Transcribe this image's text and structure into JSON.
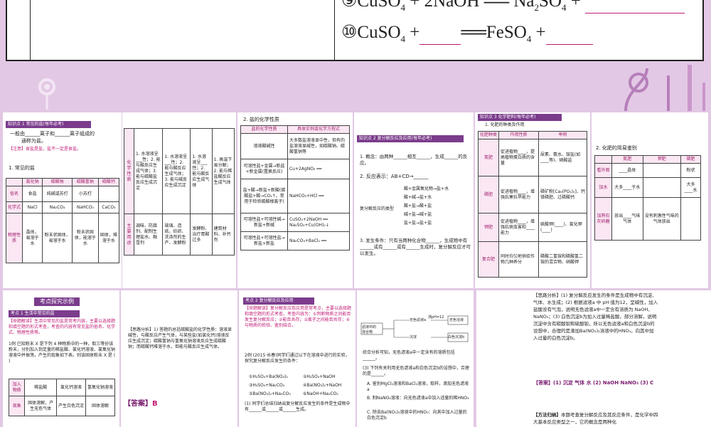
{
  "top": {
    "eq9_prefix": "⑨CuSO",
    "eq9_mid": "+2NaOH",
    "eq9_product": "Na",
    "eq9_product2": "SO",
    "eq9_plus": "+",
    "eq10_prefix": "⑩CuSO",
    "eq10_plus1": "+",
    "eq10_arrow": "══FeSO",
    "eq10_plus2": "+",
    "sub4": "4",
    "sub2": "2"
  },
  "panel1": {
    "section_title": "知识点 1 常见的盐(每年必考)",
    "line1": "一般由______离子和______离子组成的",
    "line2": "通称为盐。",
    "note": "【注意】食盐是盐，盐不一定是食盐。",
    "table_title": "1. 常见的盐",
    "headers": [
      "",
      "氯化钠",
      "碳酸钠",
      "碳酸氢钠",
      "碳酸钙"
    ],
    "row_name": [
      "俗名",
      "食盐",
      "纯碱或苏打",
      "小苏打",
      ""
    ],
    "row_formula": [
      "化学式",
      "NaCl",
      "Na₂CO₃",
      "NaHCO₃",
      "CaCO₃"
    ],
    "row_phys": [
      "物理性质",
      "晶体，易溶于水",
      "粉末状固体，易溶于水",
      "粉末状固体，能溶于水",
      "固体，难溶于水"
    ]
  },
  "panel2": {
    "col1": [
      "化学性质",
      "主要用途"
    ],
    "col2": [
      "1. 水溶液呈___性；2. 能与酸反应生成气体；3. 能与碳酸盐反应生成沉淀",
      "调味、防腐剂、配制生理盐水、融雪剂"
    ],
    "col3": [
      "1. 水溶液呈___性；2. 能与酸反应生成气体；3. 能与碱反应生成沉淀",
      "玻璃、造纸、纺织、洗涤剂的生产、发酵粉"
    ],
    "col4": [
      "1. 水溶液呈___性；2. 能与酸反应生成气体",
      "发酵粉、治疗胃酸过多"
    ],
    "col5": [
      "1. 高温下易分解；2. 能与稀盐酸反应生成气体",
      "建筑材料、补钙剂"
    ]
  },
  "panel3": {
    "title": "2. 盐的化学性质",
    "headers": [
      "盐的化学性质",
      "具体实例或化学方程式"
    ],
    "rows": [
      [
        "溶液酸碱性",
        "大多数盐溶液显中性，但有的盐溶液显碱性，如碳酸钠、碳酸氢钠等"
      ],
      [
        "可溶性盐+金属→新盐+新金属(置换反应)",
        "Cu+2AgNO₃ ══"
      ],
      [
        "盐+酸→新盐+新酸(碳酸盐+酸→CO₂↑，常用于检验碳酸根离子)",
        "NaHCO₃+HCl ══"
      ],
      [
        "可溶性盐+可溶性碱→新盐+新碱",
        "CuSO₄+2NaOH ══ Na₂SO₄+Cu(OH)₂↓"
      ],
      [
        "可溶性盐+可溶性盐→新盐+新盐",
        "Na₂CO₃+BaCl₂ ══"
      ]
    ]
  },
  "panel4": {
    "section_title": "知识点 2 复分解反应及应用(每年必考)",
    "def": "1. 概念：由两种______相互______，生成______的反应。",
    "expr": "2. 反应表示：AB+CD→______",
    "types_label": "复分解反应的类型",
    "types": [
      "酸+金属氧化物→盐+水",
      "酸+碱→盐+水",
      "酸+盐→酸+盐",
      "碱+盐→碱+盐",
      "盐+盐→盐+盐"
    ],
    "cond": "3. 发生条件：只有当两种化合物______，生成物中有______或有______或有______生成时，复分解反应才可以发生。"
  },
  "panel5": {
    "section_title": "知识点 3 化学肥料(每年必考)",
    "subtitle": "1. 化肥的种类及作用",
    "headers": [
      "化肥种类",
      "作用性质",
      "举例"
    ],
    "rows": [
      [
        "氮肥",
        "促进植物____，提高植物蛋白质的含量",
        "尿素、氨水、铵盐(如____等)、硝酸盐"
      ],
      [
        "磷肥",
        "促进植物____，增强抗寒抗旱能力",
        "磷矿粉[Ca₃(PO₄)₂]、钙镁磷肥、过磷酸钙"
      ],
      [
        "钾肥",
        "促进植物____，增强抗病虫害和____能力",
        "硫酸钾(____)、氯化钾(____)"
      ],
      [
        "复合肥",
        "同时均匀地供给作物几种养分",
        "磷酸二氢铵和磷酸氢二铵的混合物、硝酸钾"
      ]
    ]
  },
  "panel6": {
    "title": "2. 化肥的简易鉴别",
    "headers": [
      "",
      "氮肥",
      "钾肥",
      "磷肥"
    ],
    "row1": [
      "看外观",
      "____晶体",
      "",
      "粉状"
    ],
    "row2": [
      "加水",
      "大多____于水",
      "",
      "大多____水"
    ],
    "row3": [
      "加熟石灰研磨",
      "放出____气味气体",
      "没有刺激性气味的气体放出",
      ""
    ]
  },
  "panel7": {
    "banner": "考点探究示例",
    "kp_title": "考点 1 生活中常见的盐",
    "hint": "【命题解读】生活中常见的盐是常考内容，主要以选择题和填空题的形式考查，考查的内容有常见盐的俗名、化学式、物理性质等。",
    "ex": "1例 已知粉末 X 是下列 4 种物质中的一种，取三等份该粉末，分别加入到足量的稀盐酸、氯化钙溶液、氯氧化钠溶液中并振荡，产生的现象如下表。则该固体粉末 X 是 (    )",
    "t_headers": [
      "加入物质",
      "稀盐酸",
      "氯化钙溶液",
      "氢氧化钠溶液"
    ],
    "t_row": [
      "现象",
      "固体溶解，产生无色气体",
      "产生白色沉淀",
      "固体溶解"
    ]
  },
  "panel8": {
    "analysis": "【思路分析】1) 答题的总括碳酸盐的化学性质：溶液显碱性，与酸反应产生气体，与某些盐(如氯化钙)溶液反应生成沉淀；碳酸氢钠与氢氧化钠溶液反应生成碳酸钠；而碳酸钙难溶于水，但能与酸反应生成气体。",
    "answer_label": "【答案】",
    "answer": "B"
  },
  "panel9": {
    "kp_title": "考点 2 复分解反应及应用",
    "hint": "【命题解读】复分解反应及应用是常考点，主要以选择题和填空题的形式考查，考查内容为：①判断物质之间能否发生复分解反应；②能否共存；③离子之间能否共存；④与物质的检验、鉴别结合。",
    "ex": "2例 (2015·长春)同学们通过以下在溶液中进行的实验，探究复分解反应发生的条件：",
    "items": [
      "①H₂SO₄+Ba(NO₃)₂",
      "②H₂SO₄+NaOH",
      "③H₂SO₄+Na₂CO₃",
      "④Ba(NO₃)₂+NaOH",
      "⑤Ba(NO₃)₂+Na₂CO₃",
      "⑥NaOH+Na₂CO₃"
    ],
    "q1": "(1) 同学们总结归纳出复分解反应发生的条件是生成物中有______或______或______生成。"
  },
  "panel10": {
    "flow": [
      "滤液中的",
      "混合物",
      "无色滤液a",
      "沉淀",
      "白色沉淀b",
      "无色溶液"
    ],
    "ph": "测pH=12",
    "q": "综合分析可知，无色滤液a中一定含有的溶质包括______。",
    "q2": "(3) 下列有关利用无色滤液a和白色沉淀b的设想中，合理的是______。",
    "opts": [
      "A. 鉴别MgCl₂溶液和BaCl₂溶液，取样，滴加无色滤液a",
      "B. 制NaNO₃溶液：向无色滤液a中加入适量的稀HNO₃",
      "C. 除去Ba(NO₃)₂溶液中的HNO₃：向其中加入过量的白色沉淀b"
    ]
  },
  "panel11": {
    "analysis": "【思路分析】(1) 复分解反应发生的条件是生成物中有沉淀、气体、水生成；(2) 根据滤液a 中 pH 值为12，呈碱性，加入盐酸没有气泡，说明无色滤液a中一定含有溶质为 NaOH、NaNO₃；(3) 白色沉淀b为加入过量稀盐酸，部分溶解，说明沉淀中含有碳酸钡和硫酸钡，所以无色滤液a和白色沉淀b的设想中，合理的是滴加Ba(NO₃)₂溶液中的HNO₃，向其中加入过量的白色沉淀b。",
    "answer_label": "【答案】",
    "answer": "(1) 沉淀 气体 水 (2) NaOH NaNO₃ (3) C",
    "method_label": "【方法归纳】",
    "method": "本题考查复分解反应及其反应条件，是化学中四大基本反应类型之一，它的概念是两种化"
  }
}
